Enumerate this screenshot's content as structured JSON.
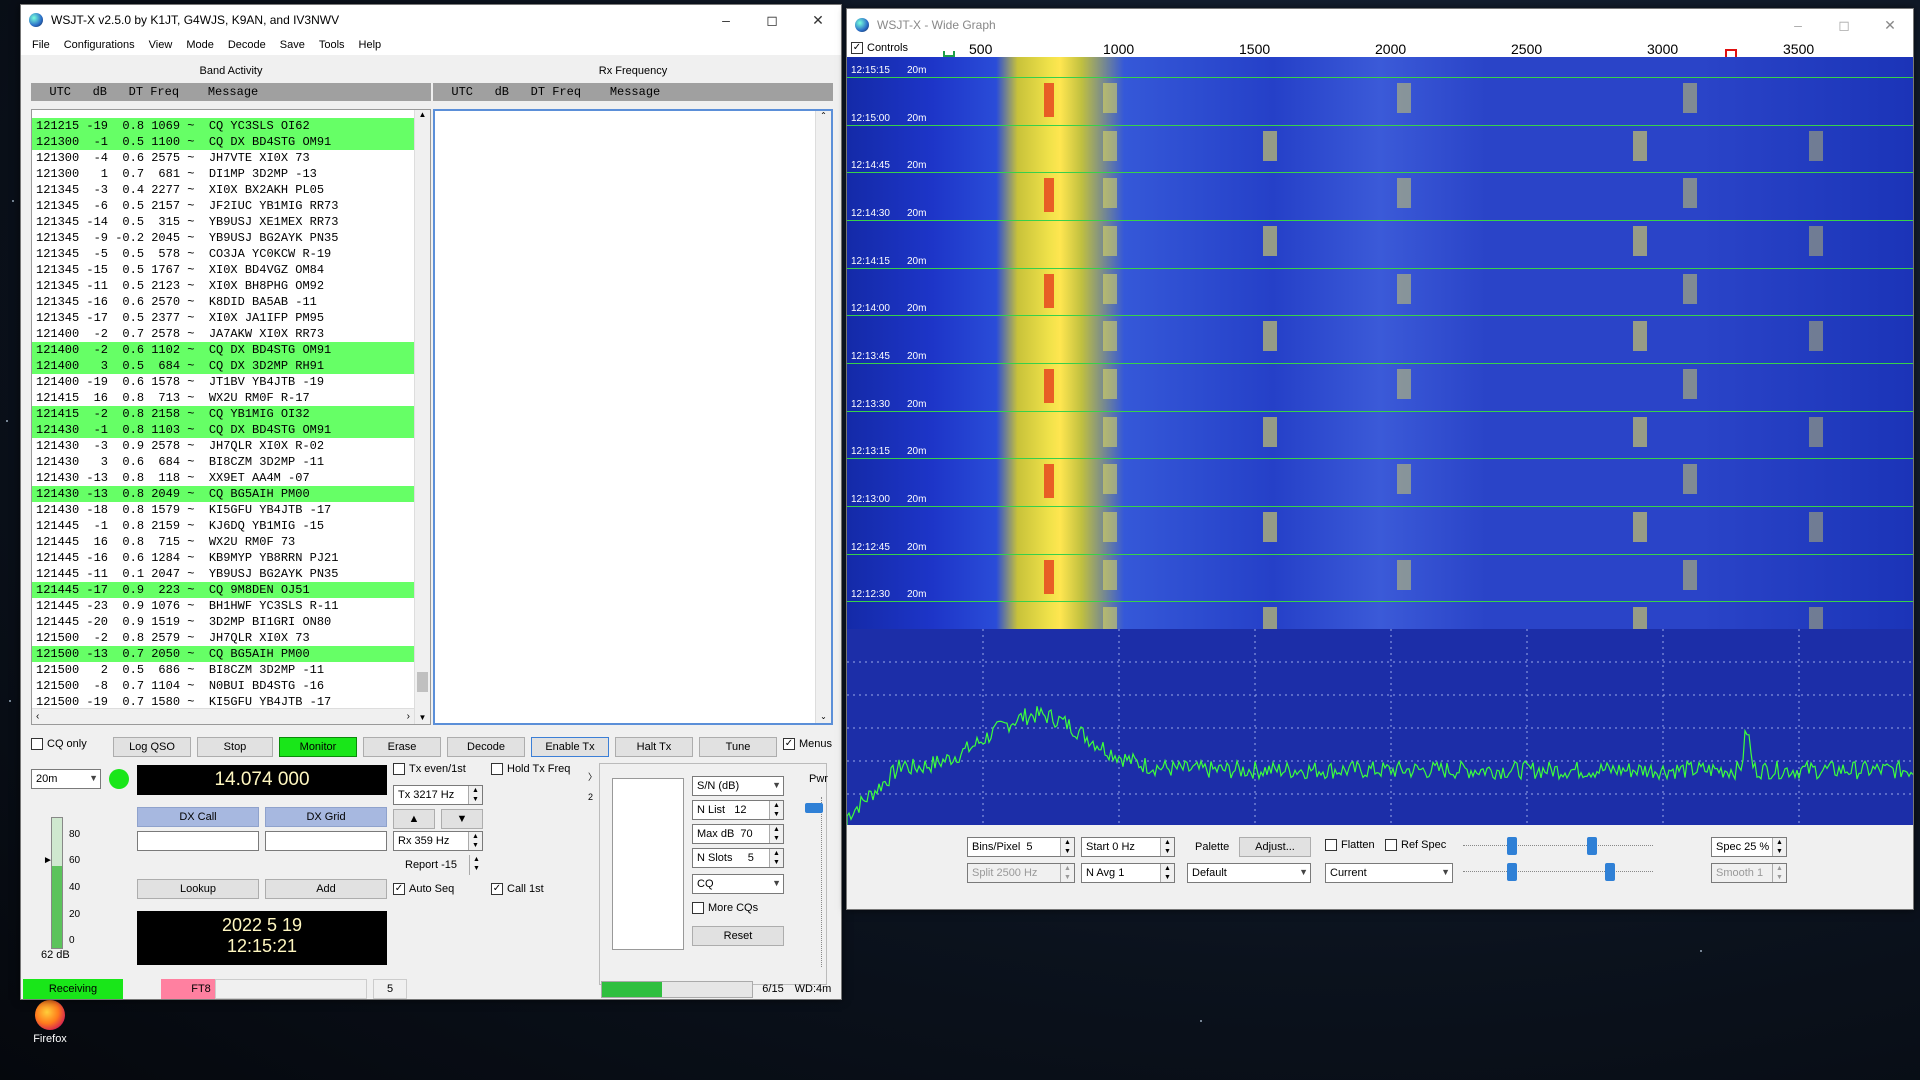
{
  "main_window": {
    "title": "WSJT-X   v2.5.0   by K1JT, G4WJS, K9AN, and IV3NWV",
    "menu": [
      "File",
      "Configurations",
      "View",
      "Mode",
      "Decode",
      "Save",
      "Tools",
      "Help"
    ],
    "band_activity_label": "Band Activity",
    "rx_frequency_label": "Rx Frequency",
    "col_header": "  UTC   dB   DT Freq    Message",
    "decodes": [
      {
        "text": "121215 -19  0.8 1069 ~  CQ YC3SLS OI62",
        "cq": true
      },
      {
        "text": "121300  -1  0.5 1100 ~  CQ DX BD4STG OM91",
        "cq": true
      },
      {
        "text": "121300  -4  0.6 2575 ~  JH7VTE XI0X 73",
        "cq": false
      },
      {
        "text": "121300   1  0.7  681 ~  DI1MP 3D2MP -13",
        "cq": false
      },
      {
        "text": "121345  -3  0.4 2277 ~  XI0X BX2AKH PL05",
        "cq": false
      },
      {
        "text": "121345  -6  0.5 2157 ~  JF2IUC YB1MIG RR73",
        "cq": false
      },
      {
        "text": "121345 -14  0.5  315 ~  YB9USJ XE1MEX RR73",
        "cq": false
      },
      {
        "text": "121345  -9 -0.2 2045 ~  YB9USJ BG2AYK PN35",
        "cq": false
      },
      {
        "text": "121345  -5  0.5  578 ~  CO3JA YC0KCW R-19",
        "cq": false
      },
      {
        "text": "121345 -15  0.5 1767 ~  XI0X BD4VGZ OM84",
        "cq": false
      },
      {
        "text": "121345 -11  0.5 2123 ~  XI0X BH8PHG OM92",
        "cq": false
      },
      {
        "text": "121345 -16  0.6 2570 ~  K8DID BA5AB -11",
        "cq": false
      },
      {
        "text": "121345 -17  0.5 2377 ~  XI0X JA1IFP PM95",
        "cq": false
      },
      {
        "text": "121400  -2  0.7 2578 ~  JA7AKW XI0X RR73",
        "cq": false
      },
      {
        "text": "121400  -2  0.6 1102 ~  CQ DX BD4STG OM91",
        "cq": true
      },
      {
        "text": "121400   3  0.5  684 ~  CQ DX 3D2MP RH91",
        "cq": true
      },
      {
        "text": "121400 -19  0.6 1578 ~  JT1BV YB4JTB -19",
        "cq": false
      },
      {
        "text": "121415  16  0.8  713 ~  WX2U RM0F R-17",
        "cq": false
      },
      {
        "text": "121415  -2  0.8 2158 ~  CQ YB1MIG OI32",
        "cq": true
      },
      {
        "text": "121430  -1  0.8 1103 ~  CQ DX BD4STG OM91",
        "cq": true
      },
      {
        "text": "121430  -3  0.9 2578 ~  JH7QLR XI0X R-02",
        "cq": false
      },
      {
        "text": "121430   3  0.6  684 ~  BI8CZM 3D2MP -11",
        "cq": false
      },
      {
        "text": "121430 -13  0.8  118 ~  XX9ET AA4M -07",
        "cq": false
      },
      {
        "text": "121430 -13  0.8 2049 ~  CQ BG5AIH PM00",
        "cq": true
      },
      {
        "text": "121430 -18  0.8 1579 ~  KI5GFU YB4JTB -17",
        "cq": false
      },
      {
        "text": "121445  -1  0.8 2159 ~  KJ6DQ YB1MIG -15",
        "cq": false
      },
      {
        "text": "121445  16  0.8  715 ~  WX2U RM0F 73",
        "cq": false
      },
      {
        "text": "121445 -16  0.6 1284 ~  KB9MYP YB8RRN PJ21",
        "cq": false
      },
      {
        "text": "121445 -11  0.1 2047 ~  YB9USJ BG2AYK PN35",
        "cq": false
      },
      {
        "text": "121445 -17  0.9  223 ~  CQ 9M8DEN OJ51",
        "cq": true
      },
      {
        "text": "121445 -23  0.9 1076 ~  BH1HWF YC3SLS R-11",
        "cq": false
      },
      {
        "text": "121445 -20  0.9 1519 ~  3D2MP BI1GRI ON80",
        "cq": false
      },
      {
        "text": "121500  -2  0.8 2579 ~  JH7QLR XI0X 73",
        "cq": false
      },
      {
        "text": "121500 -13  0.7 2050 ~  CQ BG5AIH PM00",
        "cq": true
      },
      {
        "text": "121500   2  0.5  686 ~  BI8CZM 3D2MP -11",
        "cq": false
      },
      {
        "text": "121500  -8  0.7 1104 ~  N0BUI BD4STG -16",
        "cq": false
      },
      {
        "text": "121500 -19  0.7 1580 ~  KI5GFU YB4JTB -17",
        "cq": false
      }
    ],
    "buttons": {
      "cq_only": "CQ only",
      "log_qso": "Log QSO",
      "stop": "Stop",
      "monitor": "Monitor",
      "erase": "Erase",
      "decode": "Decode",
      "enable_tx": "Enable Tx",
      "halt_tx": "Halt Tx",
      "tune": "Tune",
      "menus": "Menus",
      "dx_call": "DX Call",
      "dx_grid": "DX Grid",
      "lookup": "Lookup",
      "add": "Add",
      "reset": "Reset"
    },
    "band": "20m",
    "frequency": "14.074 000",
    "tx_even": "Tx even/1st",
    "hold_tx_freq": "Hold Tx Freq",
    "tx_hz": "Tx  3217  Hz",
    "rx_hz": "Rx  359  Hz",
    "report": "Report  -15",
    "auto_seq": "Auto Seq",
    "call_1st": "Call 1st",
    "date": "2022 5 19",
    "time": "12:15:21",
    "sn_combo": "S/N (dB)",
    "n_list": "N List",
    "n_list_val": "12",
    "max_db": "Max dB",
    "max_db_val": "70",
    "n_slots": "N Slots",
    "n_slots_val": "5",
    "cq_combo": "CQ",
    "more_cqs": "More CQs",
    "pwr": "Pwr",
    "meter_ticks": [
      "80",
      "60",
      "40",
      "20",
      "0"
    ],
    "meter_db": "62 dB",
    "meter_level": 0.62,
    "status": {
      "receiving": "Receiving",
      "mode": "FT8",
      "count": "5",
      "progress_text": "6/15",
      "wd": "WD:4m",
      "progress": 0.4
    }
  },
  "wide_graph": {
    "title": "WSJT-X - Wide Graph",
    "controls_label": "Controls",
    "freq_ticks": [
      "500",
      "1000",
      "1500",
      "2000",
      "2500",
      "3000",
      "3500"
    ],
    "time_labels": [
      "12:15:15",
      "12:15:00",
      "12:14:45",
      "12:14:30",
      "12:14:15",
      "12:14:00",
      "12:13:45",
      "12:13:30",
      "12:13:15",
      "12:13:00",
      "12:12:45",
      "12:12:30"
    ],
    "band_tag": "20m",
    "bins_pixel": "Bins/Pixel",
    "bins_val": "5",
    "start": "Start  0 Hz",
    "palette": "Palette",
    "adjust": "Adjust...",
    "flatten": "Flatten",
    "ref_spec": "Ref Spec",
    "spec": "Spec  25 %",
    "split": "Split   2500   Hz",
    "n_avg": "N Avg  1",
    "palette_val": "Default",
    "current_val": "Current",
    "smooth": "Smooth   1"
  },
  "taskbar": {
    "firefox": "Firefox"
  },
  "colors": {
    "cq_highlight": "#66ff66",
    "monitor_green": "#19e619",
    "receiving": "#19e619",
    "ft8": "#ff80a0",
    "dx_button": "#a7b8e0"
  }
}
